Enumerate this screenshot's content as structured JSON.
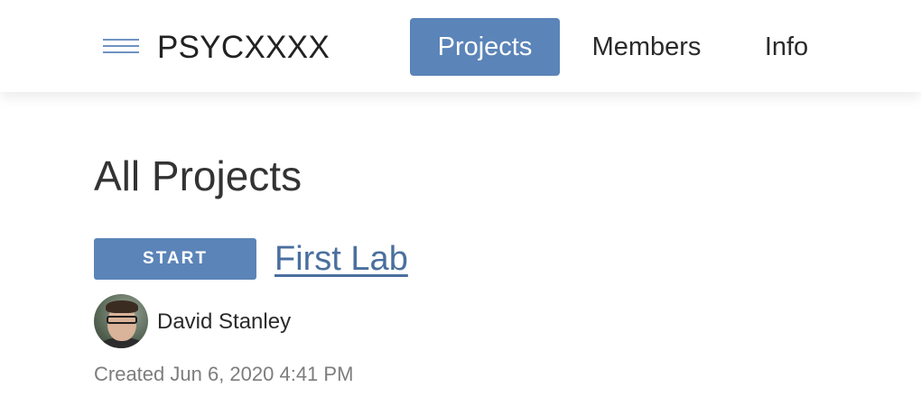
{
  "header": {
    "app_title": "PSYCXXXX",
    "menu_icon": "hamburger-menu-icon",
    "nav": [
      {
        "label": "Projects",
        "active": true
      },
      {
        "label": "Members",
        "active": false
      },
      {
        "label": "Info",
        "active": false
      }
    ]
  },
  "main": {
    "heading": "All Projects",
    "projects": [
      {
        "start_label": "START",
        "title": "First Lab",
        "author": "David Stanley",
        "created": "Created Jun 6, 2020 4:41 PM"
      }
    ]
  },
  "colors": {
    "accent": "#5b84b8",
    "link": "#4a6f9e",
    "text": "#2a2a2a",
    "muted": "#7d7d7d"
  }
}
